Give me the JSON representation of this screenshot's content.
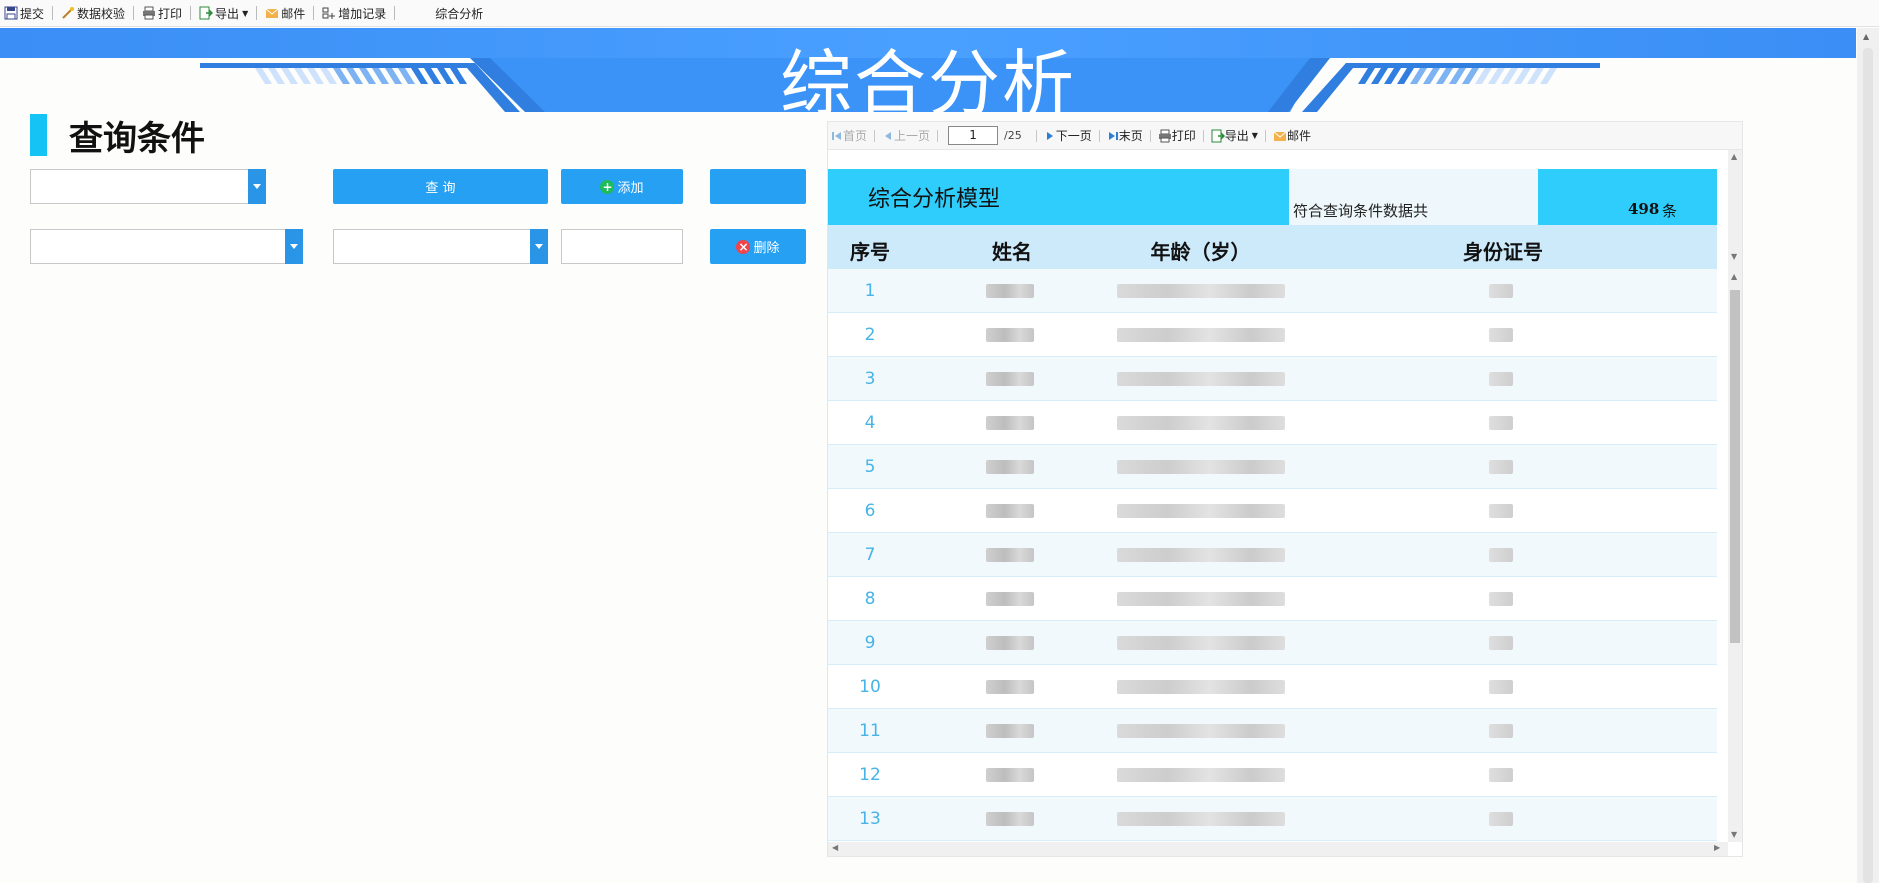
{
  "toolbar": {
    "submit": "提交",
    "validate": "数据校验",
    "print": "打印",
    "export": "导出",
    "mail": "邮件",
    "add_record": "增加记录",
    "title": "综合分析"
  },
  "banner": {
    "title": "综合分析"
  },
  "query": {
    "header": "查询条件",
    "query_button": "查 询",
    "add_button": "添加",
    "delete_button": "删除",
    "add_icon": "plus-circle-icon",
    "delete_icon": "x-circle-icon"
  },
  "report_nav": {
    "first": "首页",
    "prev": "上一页",
    "page_value": "1",
    "total_pages": "/25",
    "next": "下一页",
    "last": "末页",
    "print": "打印",
    "export": "导出",
    "mail": "邮件"
  },
  "report": {
    "title": "综合分析模型",
    "count_label": "符合查询条件数据共",
    "count_value": "498",
    "count_unit": "条",
    "columns": [
      "序号",
      "姓名",
      "年龄（岁）",
      "身份证号"
    ],
    "row_numbers": [
      "1",
      "2",
      "3",
      "4",
      "5",
      "6",
      "7",
      "8",
      "9",
      "10",
      "11",
      "12",
      "13"
    ]
  },
  "colors": {
    "accent_blue": "#26a0f3",
    "banner_blue": "#3d8ff5",
    "header_cyan": "#2ecdfb",
    "column_header": "#cdeafb",
    "row_number": "#46b4e6"
  }
}
